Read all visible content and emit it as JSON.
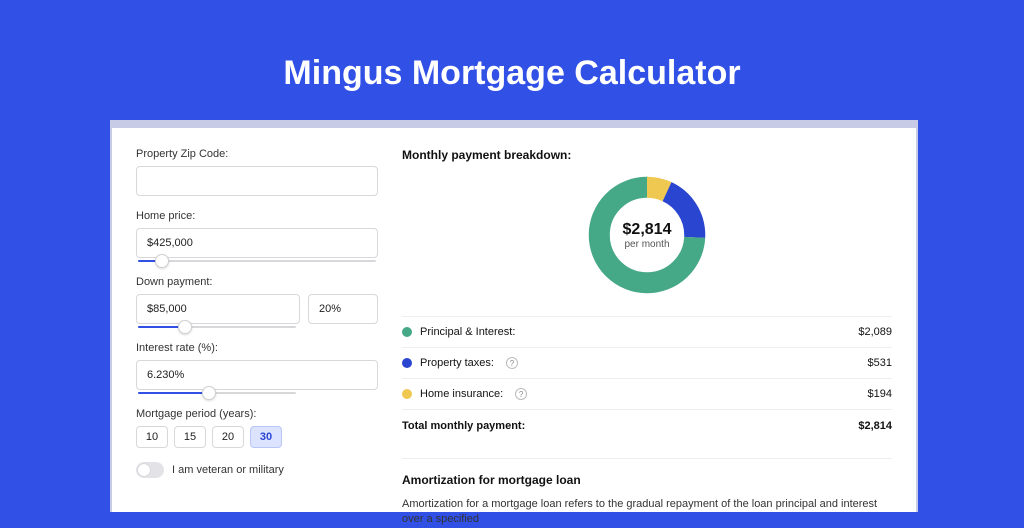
{
  "title": "Mingus Mortgage Calculator",
  "form": {
    "zip_label": "Property Zip Code:",
    "zip_value": "",
    "home_price_label": "Home price:",
    "home_price_value": "$425,000",
    "home_price_slider_pct": 10,
    "down_payment_label": "Down payment:",
    "down_payment_value": "$85,000",
    "down_payment_pct": "20%",
    "down_payment_slider_pct": 30,
    "interest_label": "Interest rate (%):",
    "interest_value": "6.230%",
    "interest_slider_pct": 45,
    "period_label": "Mortgage period (years):",
    "period_options": [
      "10",
      "15",
      "20",
      "30"
    ],
    "period_selected_index": 3,
    "veteran_label": "I am veteran or military",
    "veteran_on": false
  },
  "breakdown": {
    "heading": "Monthly payment breakdown:",
    "center_value": "$2,814",
    "center_sub": "per month",
    "colors": {
      "pi": "#45a886",
      "tax": "#2a46d1",
      "ins": "#efc851"
    },
    "items": [
      {
        "label": "Principal & Interest:",
        "value": "$2,089",
        "color": "#45a886",
        "has_info": false
      },
      {
        "label": "Property taxes:",
        "value": "$531",
        "color": "#2a46d1",
        "has_info": true
      },
      {
        "label": "Home insurance:",
        "value": "$194",
        "color": "#efc851",
        "has_info": true
      }
    ],
    "total_label": "Total monthly payment:",
    "total_value": "$2,814"
  },
  "chart_data": {
    "type": "pie",
    "title": "Monthly payment breakdown",
    "series": [
      {
        "name": "Principal & Interest",
        "value": 2089,
        "color": "#45a886"
      },
      {
        "name": "Property taxes",
        "value": 531,
        "color": "#2a46d1"
      },
      {
        "name": "Home insurance",
        "value": 194,
        "color": "#efc851"
      }
    ],
    "total": 2814,
    "donut": true
  },
  "amortization": {
    "heading": "Amortization for mortgage loan",
    "text": "Amortization for a mortgage loan refers to the gradual repayment of the loan principal and interest over a specified"
  }
}
